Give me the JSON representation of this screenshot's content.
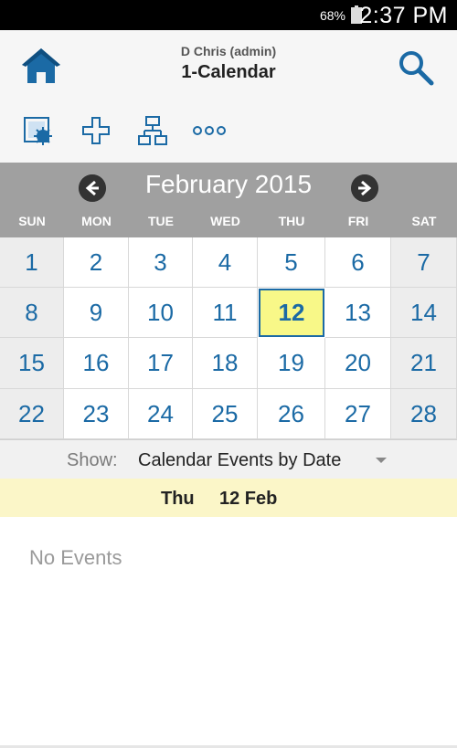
{
  "status_bar": {
    "battery_percent": "68%",
    "time": "2:37 PM"
  },
  "header": {
    "user": "D Chris (admin)",
    "title": "1-Calendar",
    "icons": {
      "home": "home-icon",
      "search": "search-icon"
    }
  },
  "toolbar": {
    "buttons": [
      {
        "icon": "calendar-image-icon"
      },
      {
        "icon": "add-icon"
      },
      {
        "icon": "hierarchy-icon"
      },
      {
        "icon": "more-icon",
        "label": "ooo"
      }
    ]
  },
  "calendar": {
    "month_title": "February 2015",
    "weekdays": [
      "SUN",
      "MON",
      "TUE",
      "WED",
      "THU",
      "FRI",
      "SAT"
    ],
    "weeks": [
      [
        "1",
        "2",
        "3",
        "4",
        "5",
        "6",
        "7"
      ],
      [
        "8",
        "9",
        "10",
        "11",
        "12",
        "13",
        "14"
      ],
      [
        "15",
        "16",
        "17",
        "18",
        "19",
        "20",
        "21"
      ],
      [
        "22",
        "23",
        "24",
        "25",
        "26",
        "27",
        "28"
      ]
    ],
    "selected_day": "12",
    "accent_color": "#1b6aa5",
    "today_color": "#f8f888"
  },
  "show": {
    "label": "Show:",
    "selected": "Calendar Events by Date"
  },
  "selected_date": {
    "day_of_week": "Thu",
    "date": "12 Feb"
  },
  "events": {
    "empty_message": "No Events"
  }
}
